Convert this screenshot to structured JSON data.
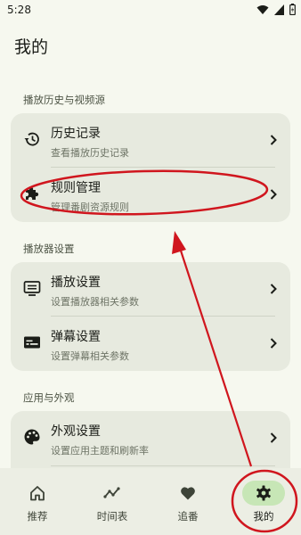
{
  "status": {
    "time": "5:28"
  },
  "page": {
    "title": "我的"
  },
  "sections": {
    "history": {
      "label": "播放历史与视频源",
      "items": [
        {
          "title": "历史记录",
          "subtitle": "查看播放历史记录",
          "icon": "history-icon"
        },
        {
          "title": "规则管理",
          "subtitle": "管理番剧资源规则",
          "icon": "puzzle-icon"
        }
      ]
    },
    "player": {
      "label": "播放器设置",
      "items": [
        {
          "title": "播放设置",
          "subtitle": "设置播放器相关参数",
          "icon": "player-settings-icon"
        },
        {
          "title": "弹幕设置",
          "subtitle": "设置弹幕相关参数",
          "icon": "danmaku-icon"
        }
      ]
    },
    "appearance": {
      "label": "应用与外观",
      "items": [
        {
          "title": "外观设置",
          "subtitle": "设置应用主题和刷新率",
          "icon": "palette-icon"
        }
      ]
    }
  },
  "nav": {
    "items": [
      {
        "label": "推荐",
        "icon": "home-icon"
      },
      {
        "label": "时间表",
        "icon": "timeline-icon"
      },
      {
        "label": "追番",
        "icon": "heart-icon"
      },
      {
        "label": "我的",
        "icon": "gear-icon"
      }
    ],
    "active": "我的"
  },
  "colors": {
    "annotation": "#d0161e",
    "nav_active": "#c7e6b6",
    "card": "#e7eadf",
    "background": "#f6f8ef"
  }
}
